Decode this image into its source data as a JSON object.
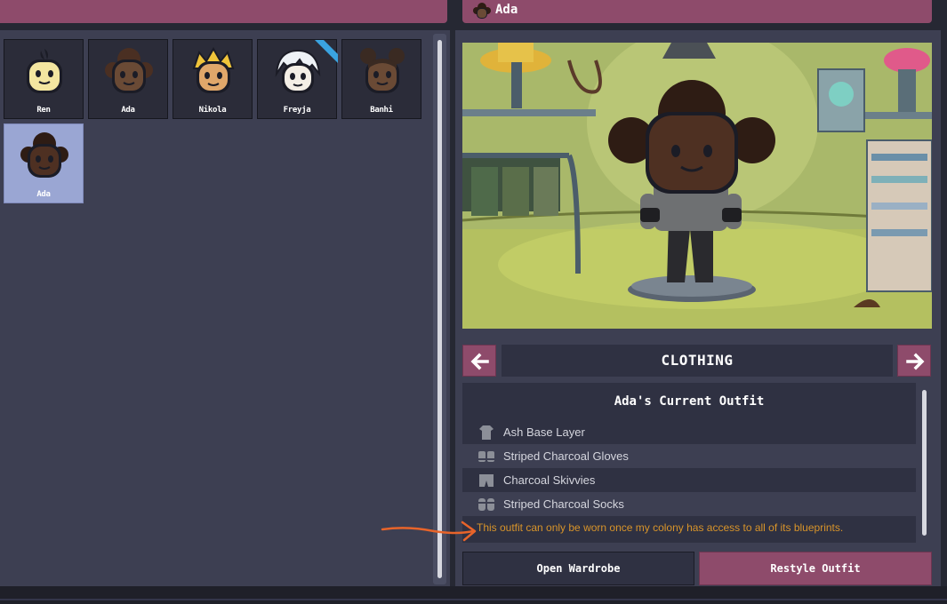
{
  "header": {
    "selected_dupe_name": "Ada"
  },
  "duplicants": [
    {
      "name": "Ren",
      "selected": false
    },
    {
      "name": "Ada",
      "selected": false
    },
    {
      "name": "Nikola",
      "selected": false
    },
    {
      "name": "Freyja",
      "selected": false
    },
    {
      "name": "Banhi",
      "selected": false
    },
    {
      "name": "Ada",
      "selected": true
    }
  ],
  "category": {
    "label": "CLOTHING",
    "prev_icon": "arrow-left-icon",
    "next_icon": "arrow-right-icon"
  },
  "outfit": {
    "title": "Ada's Current Outfit",
    "items": [
      {
        "label": "Ash Base Layer",
        "icon": "shirt-icon"
      },
      {
        "label": "Striped Charcoal Gloves",
        "icon": "gloves-icon"
      },
      {
        "label": "Charcoal Skivvies",
        "icon": "shorts-icon"
      },
      {
        "label": "Striped Charcoal Socks",
        "icon": "socks-icon"
      }
    ],
    "warning": "This outfit can only be worn once my colony has access to all of its blueprints."
  },
  "buttons": {
    "open_wardrobe": "Open Wardrobe",
    "restyle_outfit": "Restyle Outfit"
  },
  "colors": {
    "accent": "#8e4b6b",
    "panel": "#3d3f52",
    "warning": "#d8942a",
    "annotation": "#e8642a"
  }
}
